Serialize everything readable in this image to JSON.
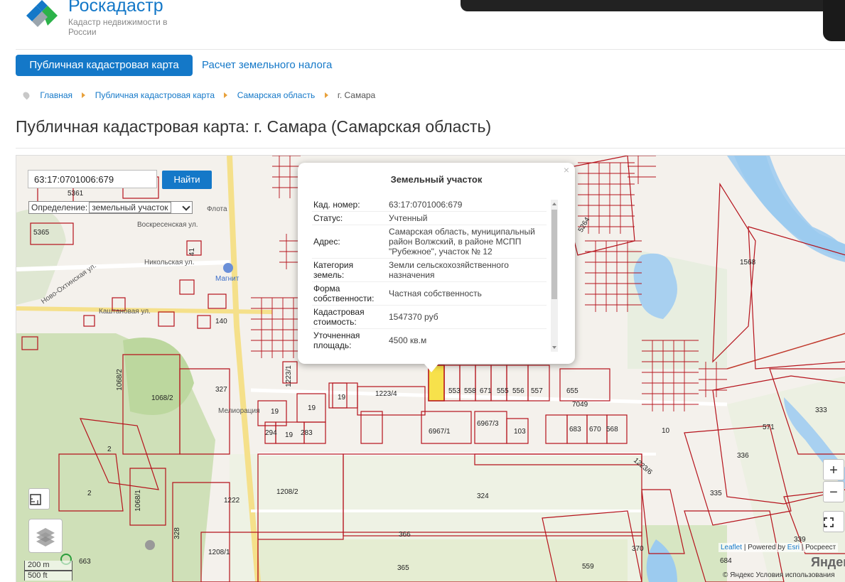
{
  "brand": {
    "name": "Роскадастр",
    "tagline": "Кадастр недвижимости в России"
  },
  "tabs": {
    "active": "Публичная кадастровая карта",
    "other": "Расчет земельного налога"
  },
  "breadcrumbs": {
    "home": "Главная",
    "map": "Публичная кадастровая карта",
    "region": "Самарская область",
    "current": "г. Самара"
  },
  "page": {
    "title": "Публичная кадастровая карта: г. Самара (Самарская область)"
  },
  "search": {
    "value": "63:17:0701006:679",
    "button": "Найти",
    "definition_label": "Определение:",
    "definition_value": "земельный участок"
  },
  "popup": {
    "title": "Земельный участок",
    "close": "×",
    "rows": [
      {
        "key": "Кад. номер:",
        "value": "63:17:0701006:679"
      },
      {
        "key": "Статус:",
        "value": "Учтенный"
      },
      {
        "key": "Адрес:",
        "value": "Самарская область, муниципальный район Волжский, в районе МСПП \"Рубежное\", участок № 12"
      },
      {
        "key": "Категория земель:",
        "value": "Земли сельскохозяйственного назначения"
      },
      {
        "key": "Форма собственности:",
        "value": "Частная собственность"
      },
      {
        "key": "Кадастровая стоимость:",
        "value": "1547370 руб"
      },
      {
        "key": "Уточненная площадь:",
        "value": "4500 кв.м"
      }
    ]
  },
  "controls": {
    "zoom_in": "+",
    "zoom_out": "−"
  },
  "scale": {
    "metric": "200 m",
    "imperial": "500 ft"
  },
  "attribution": {
    "leaflet": "Leaflet",
    "powered": "| Powered by",
    "esri": "Esri",
    "rest": "| Росреест",
    "yandex": "Яндекс",
    "terms": "© Яндекс  Условия использования"
  },
  "map_streets": [
    "Воскресенская ул.",
    "Никольская ул.",
    "Каштановая ул.",
    "Ново-Охтинская ул.",
    "Магнит",
    "Мелиорация",
    "Флота"
  ],
  "map_labels": [
    "5361",
    "5365",
    "41",
    "140",
    "1068/2",
    "1068/2",
    "327",
    "1223/1",
    "19",
    "1223/4",
    "553",
    "558",
    "671",
    "555",
    "556",
    "557",
    "655",
    "7049",
    "19",
    "19",
    "294",
    "19",
    "283",
    "6967/1",
    "6967/3",
    "103",
    "683",
    "670",
    "568",
    "2",
    "2",
    "1068/1",
    "1208/2",
    "1222",
    "324",
    "366",
    "328",
    "1208/1",
    "663",
    "365",
    "559",
    "370",
    "335",
    "336",
    "571",
    "333",
    "1568",
    "5264",
    "1223/6",
    "10",
    "684",
    "339",
    "57"
  ]
}
